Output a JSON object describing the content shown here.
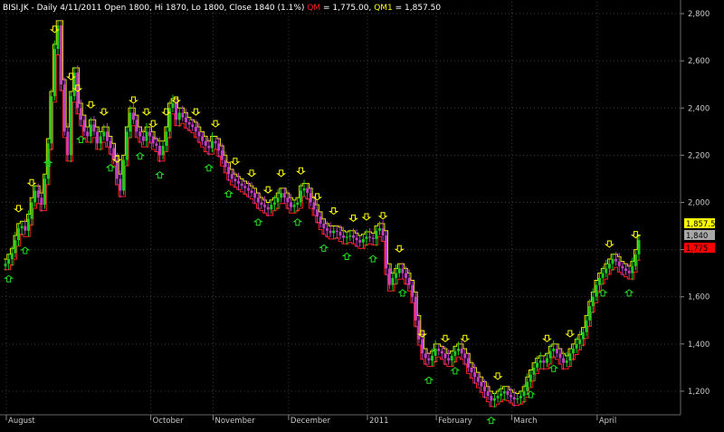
{
  "header": {
    "symbol": "BISI.JK",
    "info": " - Daily 4/11/2011 Open 1800, Hi 1870, Lo 1800, Close 1840 (1.1%) ",
    "qm_label": "QM",
    "qm_value": " = 1,775.00, ",
    "qm1_label": "QM1",
    "qm1_value": " = 1,857.50"
  },
  "price_tags": {
    "qm1": "1,857.5",
    "close": "1,840",
    "qm": "1,775"
  },
  "colors": {
    "background": "#000000",
    "grid": "#3a3a3a",
    "axis_text": "#c8c8c8",
    "title_white": "#ffffff",
    "qm_red": "#ff2020",
    "qm1_yellow": "#ffff00",
    "up_candle": "#1ec81e",
    "down_candle": "#c040c0",
    "qm_line": "#ff2020",
    "qm1_line": "#e8e800",
    "sell_arrow": "#ffff00",
    "buy_arrow": "#22dd22",
    "tag_yellow_bg": "#ffff00",
    "tag_gray_bg": "#a8a8a8",
    "tag_red_bg": "#ff0000"
  },
  "chart_data": {
    "type": "candlestick",
    "title": "BISI.JK - Daily 4/11/2011 Open 1800, Hi 1870, Lo 1800, Close 1840 (1.1%)",
    "ylim": [
      1100,
      2850
    ],
    "y_ticks": [
      1200,
      1400,
      1600,
      1800,
      2000,
      2200,
      2400,
      2600,
      2800
    ],
    "y_tick_labels": [
      "1,200",
      "1,400",
      "1,600",
      "1,800",
      "2,000",
      "2,200",
      "2,400",
      "2,600",
      "2,800"
    ],
    "x_tick_labels": [
      "August",
      "October",
      "November",
      "December",
      "2011",
      "February",
      "March",
      "April"
    ],
    "x_tick_indices": [
      0,
      44,
      63,
      86,
      110,
      131,
      154,
      180
    ],
    "closes": [
      1740,
      1760,
      1785,
      1840,
      1890,
      1900,
      1880,
      1930,
      2000,
      2050,
      2020,
      1990,
      2100,
      2250,
      2450,
      2650,
      2750,
      2500,
      2300,
      2200,
      2450,
      2550,
      2400,
      2350,
      2300,
      2280,
      2330,
      2300,
      2250,
      2280,
      2300,
      2260,
      2230,
      2180,
      2100,
      2050,
      2180,
      2300,
      2380,
      2350,
      2300,
      2280,
      2260,
      2300,
      2280,
      2250,
      2240,
      2200,
      2240,
      2300,
      2400,
      2420,
      2350,
      2380,
      2360,
      2340,
      2330,
      2320,
      2300,
      2280,
      2260,
      2240,
      2230,
      2260,
      2250,
      2220,
      2180,
      2150,
      2120,
      2100,
      2090,
      2080,
      2070,
      2060,
      2050,
      2040,
      2020,
      2000,
      1990,
      1980,
      1970,
      1990,
      2000,
      2020,
      2040,
      2020,
      2000,
      1980,
      1990,
      2000,
      2050,
      2060,
      2040,
      2000,
      1970,
      1940,
      1910,
      1890,
      1880,
      1870,
      1880,
      1875,
      1860,
      1850,
      1855,
      1860,
      1850,
      1840,
      1830,
      1845,
      1855,
      1850,
      1845,
      1880,
      1890,
      1860,
      1720,
      1650,
      1680,
      1700,
      1720,
      1700,
      1680,
      1650,
      1600,
      1500,
      1420,
      1360,
      1340,
      1330,
      1350,
      1380,
      1370,
      1360,
      1340,
      1330,
      1350,
      1370,
      1380,
      1360,
      1340,
      1300,
      1280,
      1260,
      1240,
      1220,
      1200,
      1180,
      1160,
      1170,
      1180,
      1190,
      1200,
      1185,
      1175,
      1165,
      1170,
      1180,
      1200,
      1240,
      1270,
      1300,
      1320,
      1330,
      1320,
      1340,
      1370,
      1380,
      1360,
      1340,
      1320,
      1330,
      1360,
      1380,
      1400,
      1420,
      1450,
      1500,
      1560,
      1600,
      1650,
      1680,
      1700,
      1720,
      1740,
      1760,
      1750,
      1730,
      1720,
      1710,
      1700,
      1730,
      1780,
      1840
    ],
    "sell_arrow_indices": [
      4,
      8,
      15,
      20,
      22,
      26,
      30,
      34,
      39,
      43,
      45,
      49,
      52,
      58,
      64,
      70,
      75,
      80,
      84,
      90,
      95,
      100,
      106,
      110,
      115,
      120,
      127,
      134,
      140,
      150,
      165,
      172,
      184,
      192
    ],
    "buy_arrow_indices": [
      1,
      6,
      13,
      23,
      32,
      41,
      47,
      62,
      68,
      77,
      89,
      97,
      104,
      112,
      121,
      129,
      137,
      148,
      160,
      167,
      182,
      190
    ],
    "annotations": {
      "qm": 1775.0,
      "qm1": 1857.5,
      "close": 1840
    }
  }
}
